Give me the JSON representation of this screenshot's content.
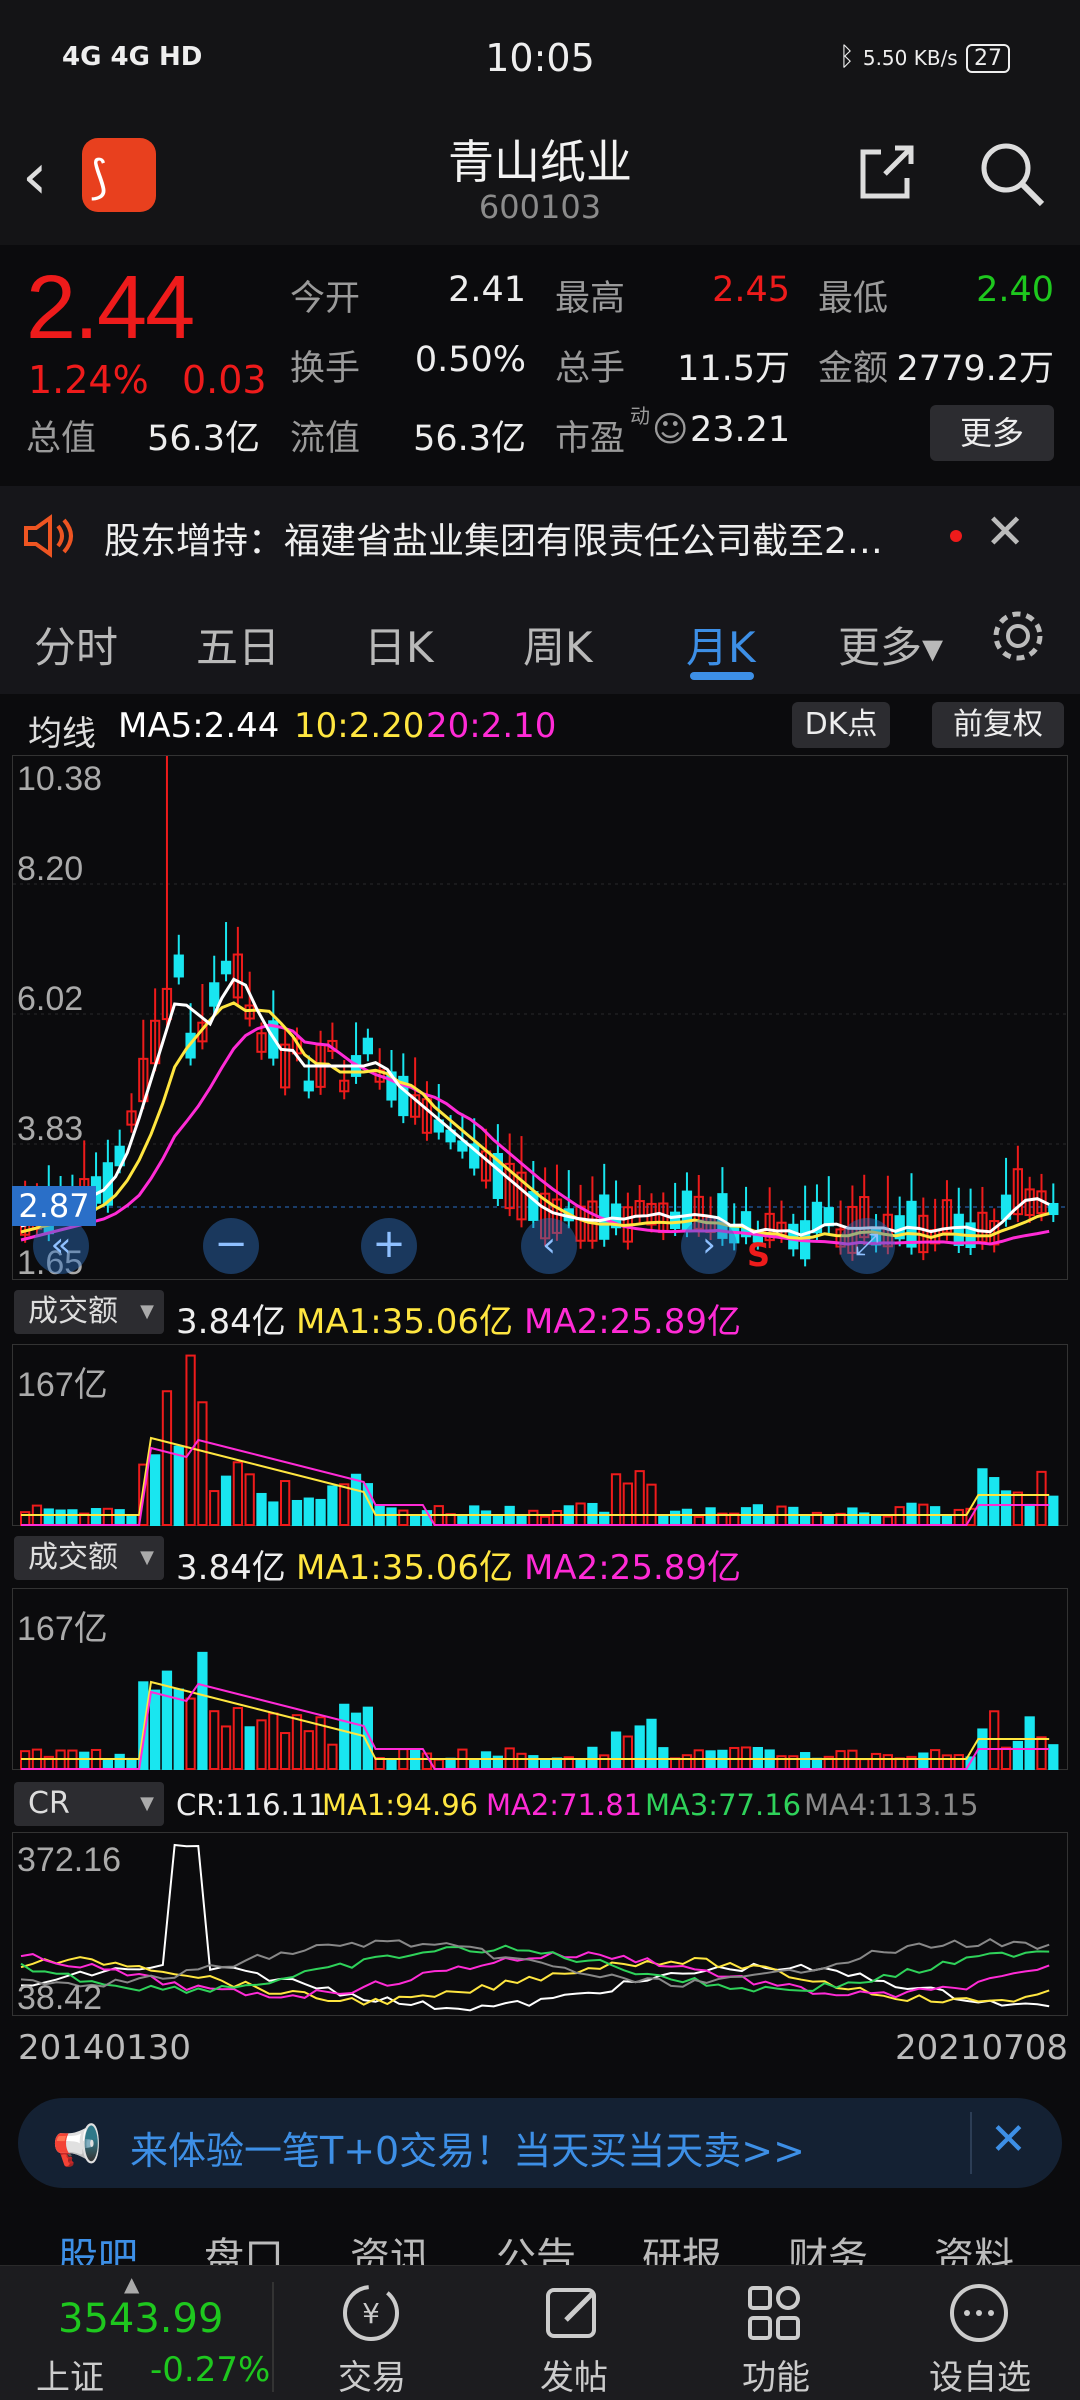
{
  "status": {
    "left": "4G 4G HD",
    "time": "10:05",
    "net": "5.50 KB/s",
    "battery": "27"
  },
  "header": {
    "name": "青山纸业",
    "code": "600103"
  },
  "quote": {
    "price": "2.44",
    "pct": "1.24%",
    "chg": "0.03",
    "labels": {
      "open": "今开",
      "high": "最高",
      "low": "最低",
      "turnover": "换手",
      "vol": "总手",
      "amount": "金额",
      "mktcap": "总值",
      "float": "流值",
      "pe": "市盈"
    },
    "values": {
      "open": "2.41",
      "high": "2.45",
      "low": "2.40",
      "turnover": "0.50%",
      "vol": "11.5万",
      "amount": "2779.2万",
      "mktcap": "56.3亿",
      "float": "56.3亿",
      "pe": "23.21"
    },
    "pe_mark": "动",
    "more": "更多"
  },
  "news": {
    "text": "股东增持：福建省盐业集团有限责任公司截至2…"
  },
  "tabs": [
    "分时",
    "五日",
    "日K",
    "周K",
    "月K",
    "更多▾"
  ],
  "ma": {
    "label": "均线",
    "ma5": "MA5:2.44",
    "ma10": "10:2.20",
    "ma20": "20:2.10",
    "dk": "DK点",
    "adj": "前复权"
  },
  "axis": {
    "y1": "10.38",
    "y2": "8.20",
    "y3": "6.02",
    "y4": "3.83",
    "y5": "1.65",
    "cur": "2.87"
  },
  "vol1": {
    "sel": "成交额",
    "val": "3.84亿",
    "ma1": "MA1:35.06亿",
    "ma2": "MA2:25.89亿",
    "top": "167亿"
  },
  "vol2": {
    "sel": "成交额",
    "val": "3.84亿",
    "ma1": "MA1:35.06亿",
    "ma2": "MA2:25.89亿",
    "top": "167亿"
  },
  "cr": {
    "sel": "CR",
    "cr": "CR:116.11",
    "ma1": "MA1:94.96",
    "ma2": "MA2:71.81",
    "ma3": "MA3:77.16",
    "ma4": "MA4:113.15",
    "top": "372.16",
    "bottom": "38.42"
  },
  "dates": {
    "start": "20140130",
    "end": "20210708"
  },
  "banner": {
    "text": "来体验一笔T+0交易！当天买当天卖>>"
  },
  "subtabs": [
    "股吧",
    "盘口",
    "资讯",
    "公告",
    "研报",
    "财务",
    "资料"
  ],
  "index": {
    "value": "3543.99",
    "name": "上证",
    "pct": "-0.27%"
  },
  "bottom": [
    "交易",
    "发帖",
    "功能",
    "设自选"
  ],
  "colors": {
    "up": "#ee1b1b",
    "down": "#1ec81e",
    "accent": "#3d8fe6",
    "ma5": "#ffffff",
    "ma10": "#ffe640",
    "ma20": "#ff2bd6",
    "cyan": "#19e6f0"
  }
}
